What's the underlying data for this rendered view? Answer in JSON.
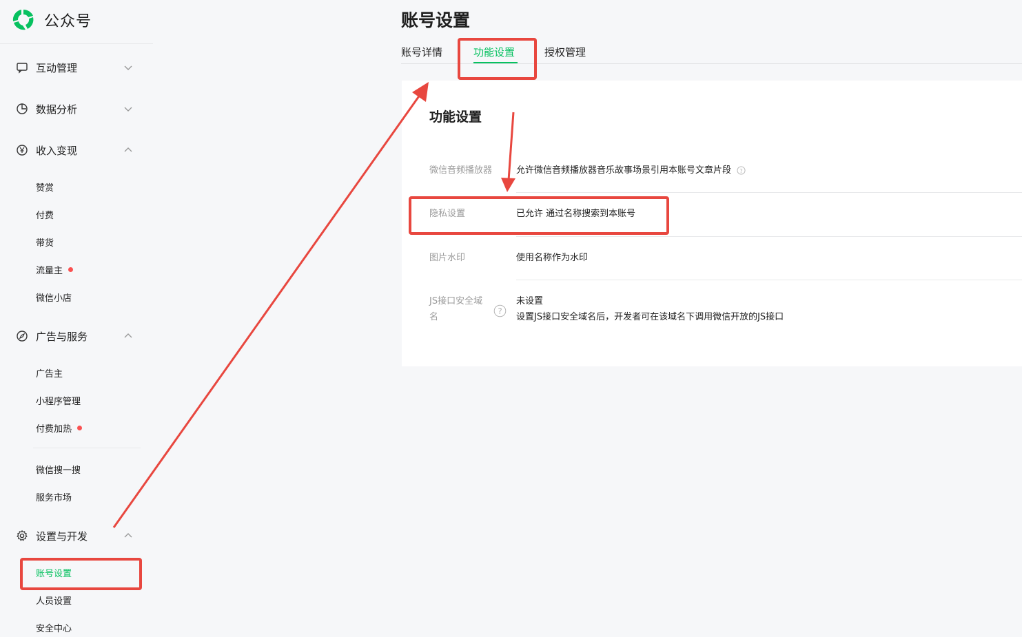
{
  "app": {
    "brand": "公众号"
  },
  "sidebar": {
    "groups": [
      {
        "label": "互动管理",
        "icon": "chat-bubble-icon",
        "expanded": false
      },
      {
        "label": "数据分析",
        "icon": "pie-chart-icon",
        "expanded": false
      },
      {
        "label": "收入变现",
        "icon": "yen-coin-icon",
        "expanded": true
      },
      {
        "label": "广告与服务",
        "icon": "compass-icon",
        "expanded": true
      },
      {
        "label": "设置与开发",
        "icon": "gear-icon",
        "expanded": true
      }
    ],
    "income_items": [
      {
        "label": "赞赏"
      },
      {
        "label": "付费"
      },
      {
        "label": "带货"
      },
      {
        "label": "流量主",
        "badge_dot": true
      },
      {
        "label": "微信小店"
      }
    ],
    "ads_items": [
      {
        "label": "广告主"
      },
      {
        "label": "小程序管理"
      },
      {
        "label": "付费加热",
        "badge_dot": true
      },
      {
        "label": "微信搜一搜"
      },
      {
        "label": "服务市场"
      }
    ],
    "settings_items": [
      {
        "label": "账号设置",
        "active": true
      },
      {
        "label": "人员设置"
      },
      {
        "label": "安全中心"
      }
    ]
  },
  "main": {
    "title": "账号设置",
    "tabs": [
      {
        "label": "账号详情",
        "active": false
      },
      {
        "label": "功能设置",
        "active": true
      },
      {
        "label": "授权管理",
        "active": false
      }
    ],
    "section_title": "功能设置",
    "rows": [
      {
        "label": "微信音频播放器",
        "value": "允许微信音频播放器音乐故事场景引用本账号文章片段",
        "help": true
      },
      {
        "label": "隐私设置",
        "value": "已允许 通过名称搜索到本账号"
      },
      {
        "label": "图片水印",
        "value": "使用名称作为水印"
      },
      {
        "label_line1": "JS接口安全域",
        "label_line2": "名",
        "help": true,
        "value": "未设置",
        "value_line2": "设置JS接口安全域名后，开发者可在该域名下调用微信开放的JS接口"
      }
    ]
  },
  "colors": {
    "accent": "#07c160",
    "annotation": "#e8473f",
    "badge": "#fa5151"
  }
}
